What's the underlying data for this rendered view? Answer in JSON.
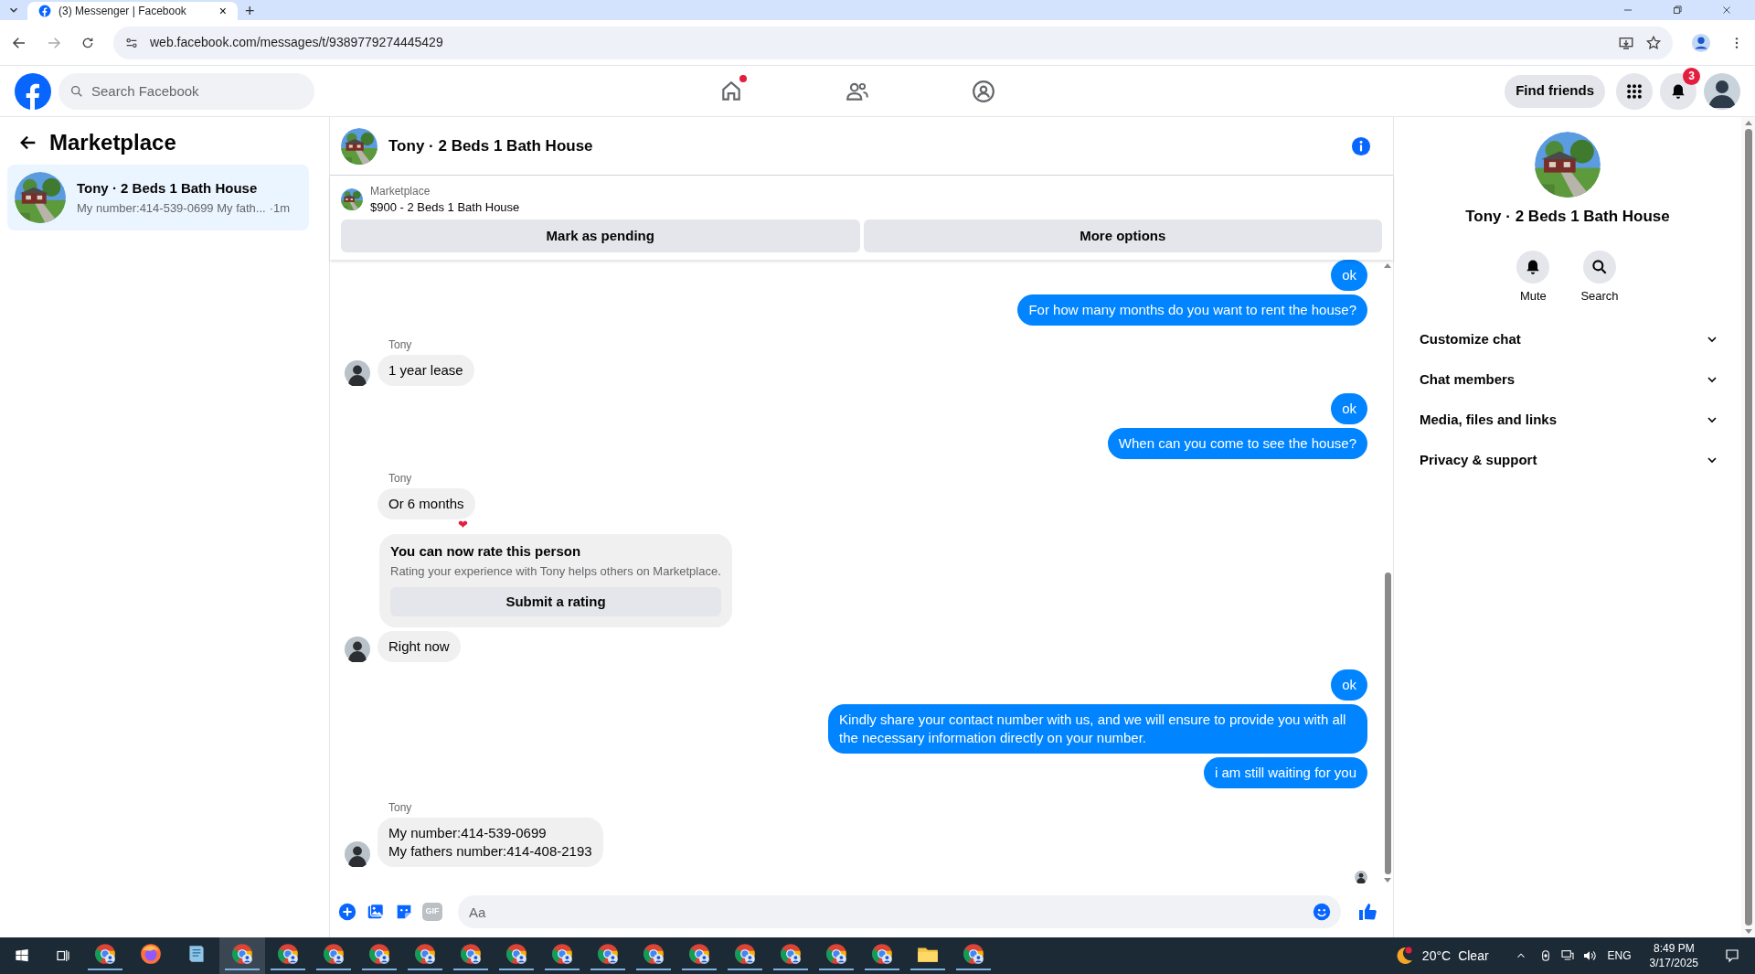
{
  "browser": {
    "tab_title": "(3) Messenger | Facebook",
    "tab_close": "×",
    "new_tab": "+",
    "url": "web.facebook.com/messages/t/9389779274445429"
  },
  "header": {
    "search_placeholder": "Search Facebook",
    "nav": [
      {
        "kind": "home",
        "dot": true
      },
      {
        "kind": "friends",
        "dot": false
      },
      {
        "kind": "groups",
        "dot": false
      }
    ],
    "find_friends": "Find friends",
    "notification_count": "3"
  },
  "sidebar": {
    "title": "Marketplace",
    "conversations": [
      {
        "name": "Tony · 2 Beds 1 Bath House",
        "preview": "My number:414-539-0699 My fath...",
        "time": "·1m",
        "selected": true
      }
    ]
  },
  "chat": {
    "title": "Tony · 2 Beds 1 Bath House",
    "listing": {
      "label": "Marketplace",
      "item": "$900 - 2 Beds 1 Bath House"
    },
    "actions": [
      "Mark as pending",
      "More options"
    ],
    "messages": [
      {
        "kind": "outgoing",
        "text": "ok"
      },
      {
        "kind": "outgoing",
        "text": "For how many months do you want to rent the house?"
      },
      {
        "kind": "incoming",
        "sender": "Tony",
        "text": "1 year lease",
        "avatar": true
      },
      {
        "kind": "outgoing",
        "text": "ok"
      },
      {
        "kind": "outgoing",
        "text": "When can you come to see the house?"
      },
      {
        "kind": "incoming",
        "sender": "Tony",
        "text": "Or 6 months",
        "avatar": false,
        "reaction": "❤"
      },
      {
        "kind": "rating_card",
        "title": "You can now rate this person",
        "text": "Rating your experience with Tony helps others on Marketplace.",
        "button": "Submit a rating"
      },
      {
        "kind": "incoming",
        "text": "Right now",
        "avatar": true
      },
      {
        "kind": "outgoing",
        "text": "ok"
      },
      {
        "kind": "outgoing",
        "text": "Kindly share your contact number with us, and we will ensure to provide you with all the necessary information directly on your number."
      },
      {
        "kind": "outgoing",
        "text": "i am still waiting for you"
      },
      {
        "kind": "incoming",
        "sender": "Tony",
        "text": "My number:414-539-0699\nMy fathers number:414-408-2193",
        "avatar": true
      }
    ],
    "seen": true,
    "composer": {
      "gif": "GIF",
      "placeholder": "Aa"
    }
  },
  "details": {
    "name": "Tony · 2 Beds 1 Bath House",
    "buttons": [
      {
        "kind": "mute",
        "label": "Mute"
      },
      {
        "kind": "search",
        "label": "Search"
      }
    ],
    "sections": [
      {
        "label": "Customize chat",
        "expanded": false
      },
      {
        "label": "Chat members",
        "expanded": false
      },
      {
        "label": "Media, files and links",
        "expanded": false
      },
      {
        "label": "Privacy & support",
        "expanded": false
      }
    ]
  },
  "taskbar": {
    "apps": [
      {
        "kind": "chrome",
        "selected": false
      },
      {
        "kind": "firefox",
        "selected": false
      },
      {
        "kind": "notes",
        "selected": false
      },
      {
        "kind": "chrome",
        "selected": true
      },
      {
        "kind": "chrome",
        "selected": false
      },
      {
        "kind": "chrome",
        "selected": false
      },
      {
        "kind": "chrome",
        "selected": false
      },
      {
        "kind": "chrome",
        "selected": false
      },
      {
        "kind": "chrome",
        "selected": false
      },
      {
        "kind": "chrome",
        "selected": false
      },
      {
        "kind": "chrome",
        "selected": false
      },
      {
        "kind": "chrome",
        "selected": false
      },
      {
        "kind": "chrome",
        "selected": false
      },
      {
        "kind": "chrome",
        "selected": false
      },
      {
        "kind": "chrome",
        "selected": false
      },
      {
        "kind": "chrome",
        "selected": false
      },
      {
        "kind": "chrome",
        "selected": false
      },
      {
        "kind": "chrome",
        "selected": false
      },
      {
        "kind": "folder",
        "selected": false
      },
      {
        "kind": "chrome",
        "selected": false
      }
    ],
    "weather": {
      "temp": "20°C",
      "condition": "Clear"
    },
    "language": "ENG",
    "time": "8:49 PM",
    "date": "3/17/2025"
  }
}
